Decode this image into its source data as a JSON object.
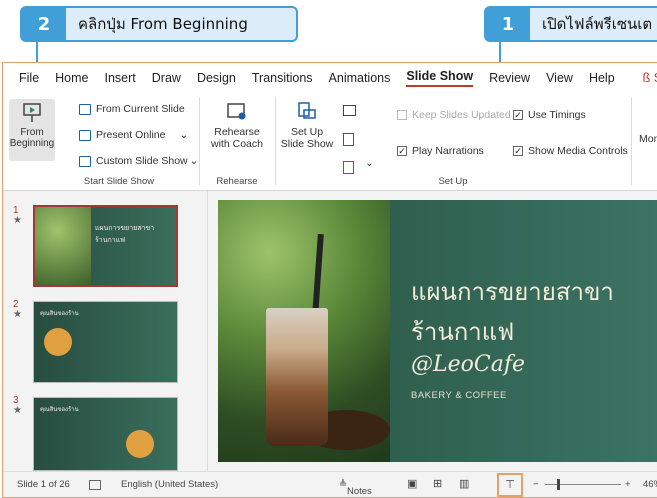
{
  "callouts": {
    "step1": {
      "number": "1",
      "text": "เปิดไฟล์พรีเซนเต"
    },
    "step2": {
      "number": "2",
      "text": "คลิกปุ่ม From Beginning"
    }
  },
  "menu": [
    "File",
    "Home",
    "Insert",
    "Draw",
    "Design",
    "Transitions",
    "Animations",
    "Slide Show",
    "Review",
    "View",
    "Help"
  ],
  "menu_active": "Slide Show",
  "menu_share": "ß Sl",
  "ribbon": {
    "from_beginning_1": "From",
    "from_beginning_2": "Beginning",
    "from_current": "From Current Slide",
    "present_online": "Present Online",
    "custom_show": "Custom Slide Show",
    "group_start": "Start Slide Show",
    "rehearse_1": "Rehearse",
    "rehearse_2": "with Coach",
    "group_rehearse": "Rehearse",
    "setup_1": "Set Up",
    "setup_2": "Slide Show",
    "keep_updated": "Keep Slides Updated",
    "use_timings": "Use Timings",
    "play_narrations": "Play Narrations",
    "show_media": "Show Media Controls",
    "group_setup": "Set Up",
    "monitor": "Mon"
  },
  "thumbnails": [
    {
      "num": "1",
      "star": "★",
      "title": "แผนการขยายสาขา",
      "sub": "ร้านกาแฟ"
    },
    {
      "num": "2",
      "star": "★",
      "title": "คุณสินของร้าน"
    },
    {
      "num": "3",
      "star": "★",
      "title": "คุณสินของร้าน"
    }
  ],
  "slide": {
    "title1": "แผนการขยายสาขา",
    "title2": "ร้านกาแฟ",
    "handle": "@LeoCafe",
    "tagline": "BAKERY & COFFEE"
  },
  "status": {
    "slide": "Slide 1 of 26",
    "language": "English (United States)",
    "notes": "Notes",
    "zoom": "46%"
  },
  "colors": {
    "accent": "#3f9fd6",
    "callout_bg": "#dcecf8",
    "slide_bg": "#2f5f4f",
    "highlight": "#e2a26a"
  }
}
